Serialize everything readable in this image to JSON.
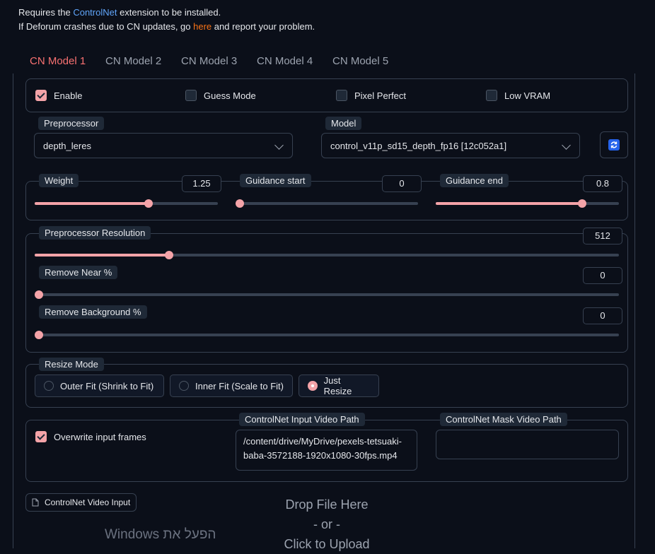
{
  "info": {
    "line1_pre": "Requires the ",
    "line1_link": "ControlNet",
    "line1_post": " extension to be installed.",
    "line2_pre": "If Deforum crashes due to CN updates, go ",
    "line2_link": "here",
    "line2_post": " and report your problem."
  },
  "tabs": [
    "CN Model 1",
    "CN Model 2",
    "CN Model 3",
    "CN Model 4",
    "CN Model 5"
  ],
  "active_tab": 0,
  "options": {
    "enable": {
      "label": "Enable",
      "checked": true
    },
    "guess_mode": {
      "label": "Guess Mode",
      "checked": false
    },
    "pixel_perfect": {
      "label": "Pixel Perfect",
      "checked": false
    },
    "low_vram": {
      "label": "Low VRAM",
      "checked": false
    }
  },
  "preprocessor": {
    "label": "Preprocessor",
    "value": "depth_leres"
  },
  "model": {
    "label": "Model",
    "value": "control_v11p_sd15_depth_fp16 [12c052a1]"
  },
  "refresh_icon": "refresh-icon",
  "sliders": {
    "weight": {
      "label": "Weight",
      "value": "1.25",
      "fraction": 0.62
    },
    "guidance_start": {
      "label": "Guidance start",
      "value": "0",
      "fraction": 0.0
    },
    "guidance_end": {
      "label": "Guidance end",
      "value": "0.8",
      "fraction": 0.8
    },
    "preprocessor_resolution": {
      "label": "Preprocessor Resolution",
      "value": "512",
      "fraction": 0.23
    },
    "remove_near": {
      "label": "Remove Near %",
      "value": "0",
      "fraction": 0.0
    },
    "remove_background": {
      "label": "Remove Background %",
      "value": "0",
      "fraction": 0.0
    }
  },
  "resize_mode": {
    "label": "Resize Mode",
    "options": [
      "Outer Fit (Shrink to Fit)",
      "Inner Fit (Scale to Fit)",
      "Just Resize"
    ],
    "selected": 2
  },
  "overwrite": {
    "label": "Overwrite input frames",
    "checked": true
  },
  "input_video": {
    "label": "ControlNet Input Video Path",
    "value": "/content/drive/MyDrive/pexels-tetsuaki-baba-3572188-1920x1080-30fps.mp4"
  },
  "mask_video": {
    "label": "ControlNet Mask Video Path",
    "value": ""
  },
  "file_input": {
    "label": "ControlNet Video Input",
    "icon": "file-icon"
  },
  "dropzone": {
    "line1": "Drop File Here",
    "line2": "- or -",
    "line3": "Click to Upload"
  },
  "watermark": "הפעל את Windows",
  "colors": {
    "accent": "#f4a3a8",
    "active_tab": "#f87171",
    "link_blue": "#60a5fa",
    "link_orange": "#f97316",
    "background": "#0b0f19",
    "border": "#374151"
  }
}
